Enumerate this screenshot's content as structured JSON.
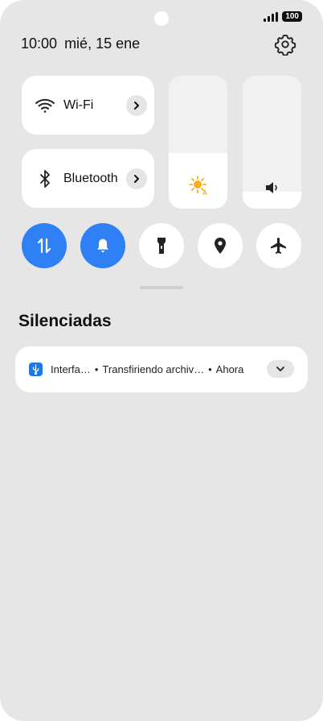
{
  "status_bar": {
    "battery": "100"
  },
  "header": {
    "time": "10:00",
    "date": "mié, 15 ene"
  },
  "tiles": {
    "wifi": {
      "label": "Wi-Fi"
    },
    "bluetooth": {
      "label": "Bluetooth"
    }
  },
  "sliders": {
    "brightness": {
      "level": 0.42
    },
    "volume": {
      "level": 0.13
    }
  },
  "toggles": [
    {
      "name": "mobile-data",
      "icon": "data-transfer-icon",
      "active": true
    },
    {
      "name": "sound",
      "icon": "bell-icon",
      "active": true
    },
    {
      "name": "flashlight",
      "icon": "flashlight-icon",
      "active": false
    },
    {
      "name": "location",
      "icon": "location-pin-icon",
      "active": false
    },
    {
      "name": "airplane",
      "icon": "airplane-icon",
      "active": false
    }
  ],
  "section": {
    "title": "Silenciadas"
  },
  "notification": {
    "app": "Interfa…",
    "text": "Transfiriendo archiv…",
    "time": "Ahora",
    "separator": "•"
  },
  "colors": {
    "accent": "#2f80f5",
    "brightness_icon": "#f2b01e",
    "panel_bg": "#e6e6e6"
  }
}
